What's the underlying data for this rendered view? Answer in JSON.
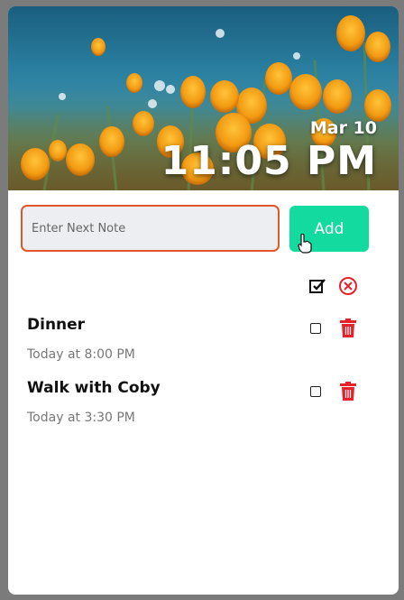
{
  "header": {
    "date": "Mar 10",
    "time": "11:05 PM"
  },
  "note_input": {
    "placeholder": "Enter Next Note",
    "value": ""
  },
  "add_button": {
    "label": "Add"
  },
  "bulk_actions": {
    "check_all_icon": "check-all-icon",
    "clear_icon": "circle-x-icon"
  },
  "notes": [
    {
      "title": "Dinner",
      "time": "Today at 8:00 PM",
      "checked": false
    },
    {
      "title": "Walk with Coby",
      "time": "Today at 3:30 PM",
      "checked": false
    }
  ],
  "colors": {
    "accent": "#13dba0",
    "input_border": "#e1572a",
    "delete": "#e8202a",
    "background": "#7b7b7b"
  }
}
